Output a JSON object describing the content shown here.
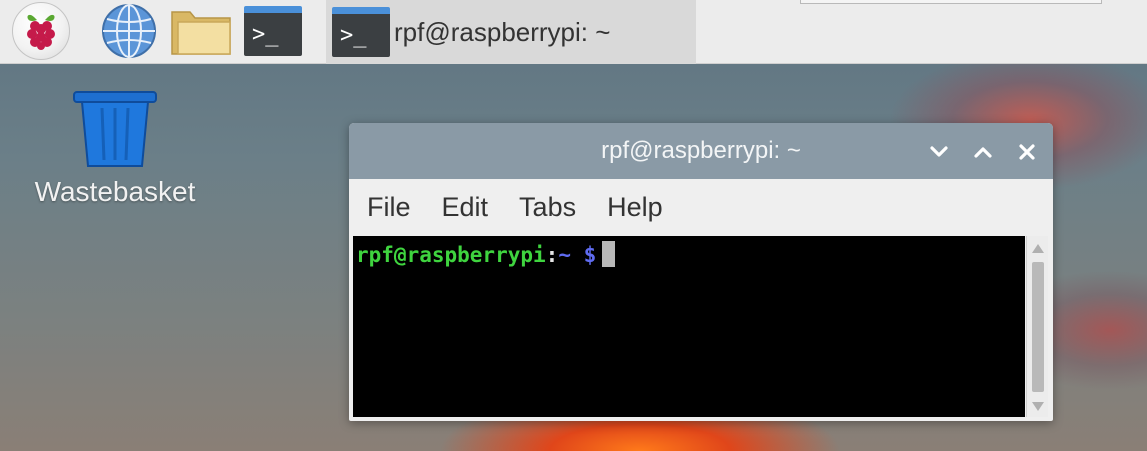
{
  "taskbar": {
    "launchers": [
      {
        "name": "raspberry-menu",
        "icon": "raspberry-pi-icon"
      },
      {
        "name": "web-browser",
        "icon": "globe-icon"
      },
      {
        "name": "file-manager",
        "icon": "folder-icon"
      },
      {
        "name": "terminal",
        "icon": "terminal-icon",
        "glyph": ">_"
      }
    ],
    "task_item": {
      "label": "rpf@raspberrypi: ~",
      "icon": "terminal-icon",
      "glyph": ">_"
    }
  },
  "desktop": {
    "icons": [
      {
        "label": "Wastebasket",
        "icon": "trash-icon"
      }
    ]
  },
  "window": {
    "title": "rpf@raspberrypi: ~",
    "controls": [
      "minimize",
      "maximize",
      "close"
    ],
    "menu": [
      "File",
      "Edit",
      "Tabs",
      "Help"
    ],
    "terminal": {
      "prompt_user": "rpf@raspberrypi",
      "prompt_sep": ":",
      "prompt_path": "~",
      "prompt_symbol": "$",
      "colors": {
        "user": "#3fd43f",
        "path": "#5f6bf0",
        "background": "#000000"
      }
    }
  },
  "colors": {
    "titlebar": "#8a9aa6",
    "taskbar": "#ececec",
    "accent": "#4a90d9"
  }
}
